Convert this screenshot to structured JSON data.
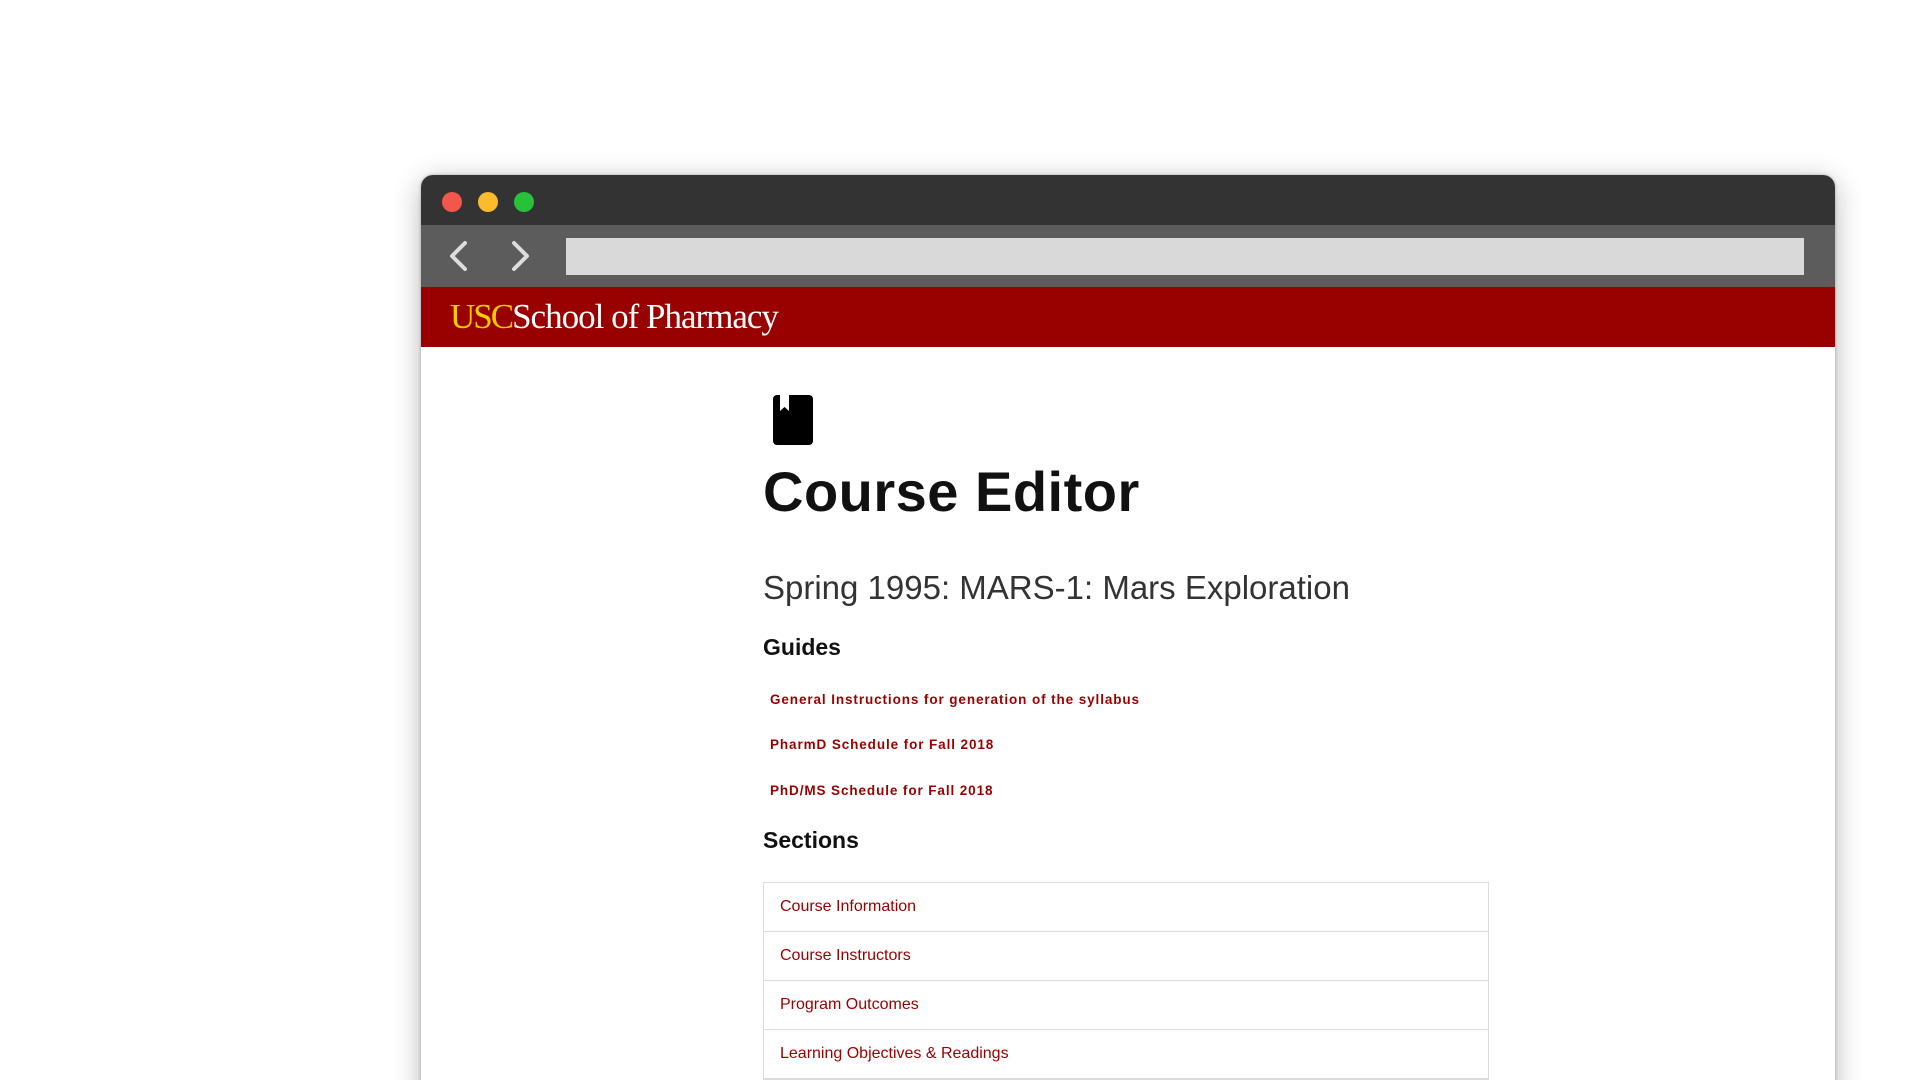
{
  "browser": {
    "address_value": "",
    "colors": {
      "titlebar": "#333333",
      "navbar": "#5c5c5c",
      "address_bar": "#d9d9d9",
      "close": "#f4564c",
      "minimize": "#fbbb2d",
      "maximize": "#27c23a"
    },
    "icons": {
      "back": "chevron-left-icon",
      "forward": "chevron-right-icon"
    }
  },
  "header": {
    "logo_usc": "USC",
    "logo_school": "School of Pharmacy",
    "colors": {
      "brand_cardinal": "#990000",
      "brand_gold": "#ffcc00"
    }
  },
  "page": {
    "icon": "book-icon",
    "title": "Course Editor",
    "course": "Spring 1995: MARS-1: Mars Exploration",
    "guides_heading": "Guides",
    "guides": [
      {
        "label": "General Instructions for generation of the syllabus"
      },
      {
        "label": "PharmD Schedule for Fall 2018"
      },
      {
        "label": "PhD/MS Schedule for Fall 2018"
      }
    ],
    "sections_heading": "Sections",
    "sections": [
      {
        "label": "Course Information"
      },
      {
        "label": "Course Instructors"
      },
      {
        "label": "Program Outcomes"
      },
      {
        "label": "Learning Objectives & Readings"
      }
    ]
  }
}
